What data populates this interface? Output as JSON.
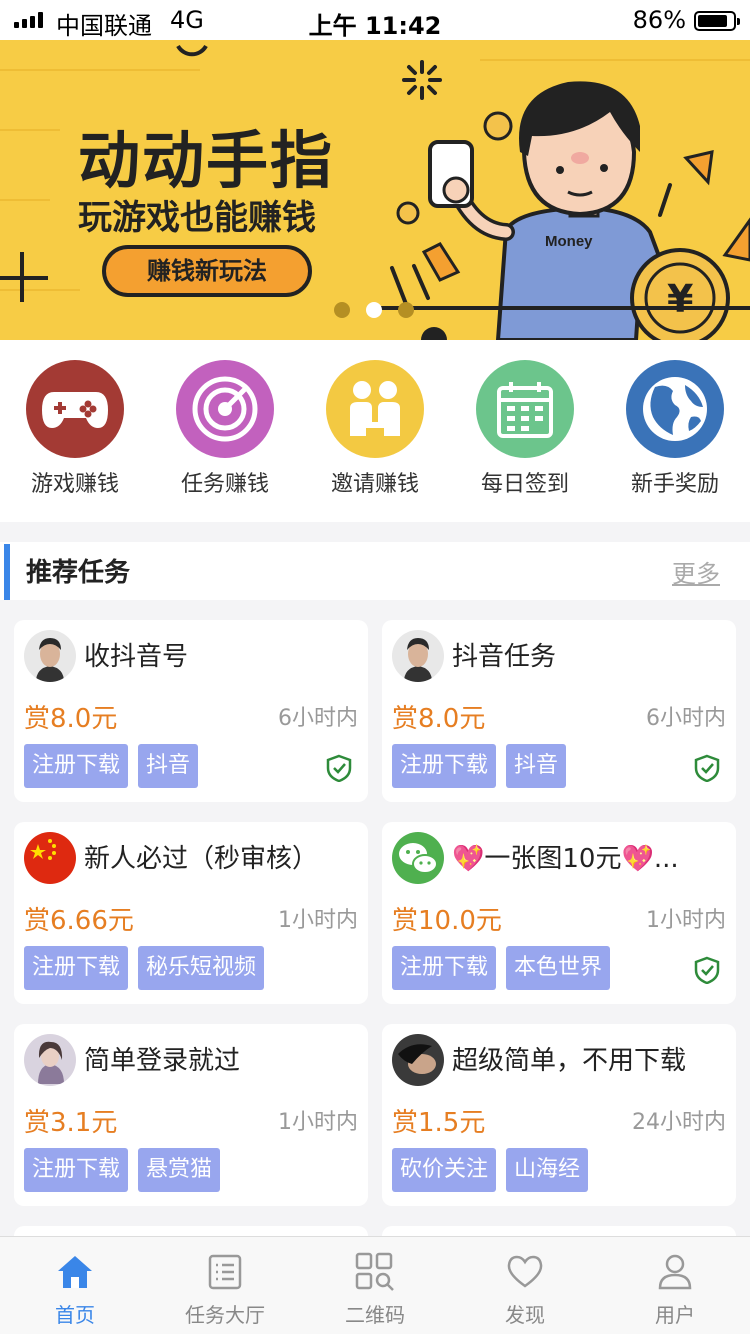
{
  "status_bar": {
    "carrier": "中国联通",
    "network": "4G",
    "time": "上午 11:42",
    "battery": "86%",
    "battery_level": 0.86
  },
  "banner": {
    "title": "动动手指",
    "subtitle": "玩游戏也能赚钱",
    "button_label": "赚钱新玩法",
    "shirt_text": "Money",
    "coin_symbol": "¥",
    "page_index": 2,
    "page_count": 3,
    "background_color": "#f7cc45"
  },
  "quick_menu": [
    {
      "label": "游戏赚钱",
      "icon": "gamepad-icon",
      "color": "#a33a34"
    },
    {
      "label": "任务赚钱",
      "icon": "radar-icon",
      "color": "#c261be"
    },
    {
      "label": "邀请赚钱",
      "icon": "handshake-icon",
      "color": "#f3c942"
    },
    {
      "label": "每日签到",
      "icon": "calendar-icon",
      "color": "#6cc58c"
    },
    {
      "label": "新手奖励",
      "icon": "globe-icon",
      "color": "#3a73b8"
    }
  ],
  "section": {
    "title": "推荐任务",
    "more": "更多"
  },
  "tasks": [
    {
      "title": "收抖音号",
      "reward": "赏8.0元",
      "time": "6小时内",
      "tags": [
        "注册下载",
        "抖音"
      ],
      "verified": true,
      "avatar": "person-avatar"
    },
    {
      "title": "抖音任务",
      "reward": "赏8.0元",
      "time": "6小时内",
      "tags": [
        "注册下载",
        "抖音"
      ],
      "verified": true,
      "avatar": "person-avatar"
    },
    {
      "title": "新人必过（秒审核）",
      "reward": "赏6.66元",
      "time": "1小时内",
      "tags": [
        "注册下载",
        "秘乐短视频"
      ],
      "verified": false,
      "avatar": "china-flag-avatar"
    },
    {
      "title": "💖一张图10元💖...",
      "reward": "赏10.0元",
      "time": "1小时内",
      "tags": [
        "注册下载",
        "本色世界"
      ],
      "verified": true,
      "avatar": "wechat-avatar"
    },
    {
      "title": "简单登录就过",
      "reward": "赏3.1元",
      "time": "1小时内",
      "tags": [
        "注册下载",
        "悬赏猫"
      ],
      "verified": false,
      "avatar": "girl-avatar"
    },
    {
      "title": "超级简单，不用下载",
      "reward": "赏1.5元",
      "time": "24小时内",
      "tags": [
        "砍价关注",
        "山海经"
      ],
      "verified": false,
      "avatar": "dark-avatar"
    }
  ],
  "tab_bar": [
    {
      "label": "首页",
      "icon": "home-icon",
      "active": true
    },
    {
      "label": "任务大厅",
      "icon": "list-icon",
      "active": false
    },
    {
      "label": "二维码",
      "icon": "qrcode-icon",
      "active": false
    },
    {
      "label": "发现",
      "icon": "heart-icon",
      "active": false
    },
    {
      "label": "用户",
      "icon": "user-icon",
      "active": false
    }
  ],
  "colors": {
    "accent": "#3a86e8",
    "reward": "#e67e22",
    "tag": "#98a6ee",
    "verified": "#2e8b3a"
  }
}
